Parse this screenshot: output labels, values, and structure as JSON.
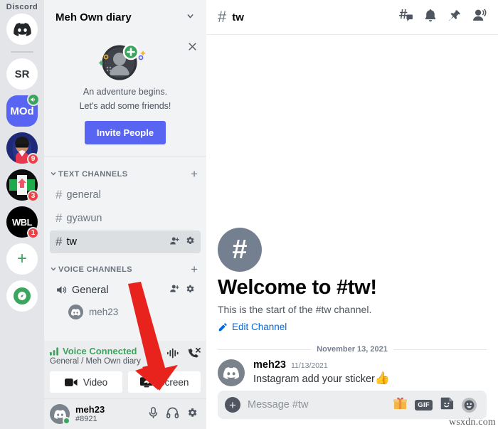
{
  "brand": {
    "wordmark": "Discord",
    "accent": "#5865f2",
    "online": "#3ba55d",
    "alert": "#ed4245",
    "link": "#0068e0"
  },
  "server_rail": {
    "home_icon": "discord-logo-icon",
    "servers": [
      {
        "name": "SR",
        "type": "text",
        "badge": "",
        "voice_badge": false,
        "color": "#ffffff"
      },
      {
        "name": "MOd",
        "type": "text",
        "badge": "",
        "voice_badge": true,
        "color": "#5865f2"
      },
      {
        "name": "",
        "type": "avatar-person",
        "badge": "9",
        "voice_badge": false,
        "color": "#1e2a78"
      },
      {
        "name": "",
        "type": "avatar-house",
        "badge": "3",
        "voice_badge": false,
        "color": "#111111"
      },
      {
        "name": "WBL",
        "type": "text",
        "badge": "1",
        "voice_badge": false,
        "color": "#000000"
      }
    ],
    "add_server_label": "+",
    "explore_label": "compass-icon"
  },
  "sidebar": {
    "guild_name": "Meh Own diary",
    "guild_dropdown_icon": "chevron-down-icon",
    "invite_card": {
      "close_icon": "close-icon",
      "line1": "An adventure begins.",
      "line2": "Let's add some friends!",
      "button_label": "Invite People"
    },
    "categories": [
      {
        "label": "TEXT CHANNELS",
        "add_label": "+",
        "channels": [
          {
            "name": "general",
            "active": false,
            "has_actions": false
          },
          {
            "name": "gyawun",
            "active": false,
            "has_actions": false
          },
          {
            "name": "tw",
            "active": true,
            "has_actions": true
          }
        ]
      },
      {
        "label": "VOICE CHANNELS",
        "add_label": "+",
        "channels": [
          {
            "name": "General",
            "active": false,
            "has_actions": true
          }
        ],
        "members": [
          {
            "name": "meh23"
          }
        ]
      }
    ],
    "voice_panel": {
      "status": "Voice Connected",
      "subtitle": "General / Meh Own diary",
      "signal_icon": "signal-bars-icon",
      "noise_icon": "soundwave-icon",
      "disconnect_icon": "phone-hangup-icon",
      "video_label": "Video",
      "screen_label": "Screen"
    },
    "user_panel": {
      "username": "meh23",
      "discriminator": "#8921",
      "mic_icon": "microphone-icon",
      "headphones_icon": "headphones-icon",
      "settings_icon": "gear-icon"
    }
  },
  "main": {
    "header": {
      "hash": "#",
      "channel_name": "tw",
      "icons": [
        "threads-icon",
        "bell-icon",
        "pin-icon",
        "members-icon"
      ]
    },
    "welcome": {
      "icon": "#",
      "title": "Welcome to #tw!",
      "subtitle": "This is the start of the #tw channel.",
      "edit_label": "Edit Channel",
      "edit_icon": "pencil-icon"
    },
    "date_divider": "November 13, 2021",
    "messages": [
      {
        "author": "meh23",
        "timestamp": "11/13/2021",
        "text": "Instagram add your sticker",
        "emoji": "👍",
        "avatar_icon": "discord-avatar-icon"
      }
    ],
    "composer": {
      "plus_icon": "plus-circle-icon",
      "placeholder": "Message #tw",
      "gift_icon": "gift-icon",
      "gif_label": "GIF",
      "sticker_icon": "sticker-icon",
      "emoji_icon": "emoji-icon"
    }
  },
  "annotation": {
    "arrow": "red-arrow-pointing-to-screen-button"
  },
  "watermark": "wsxdn.com"
}
